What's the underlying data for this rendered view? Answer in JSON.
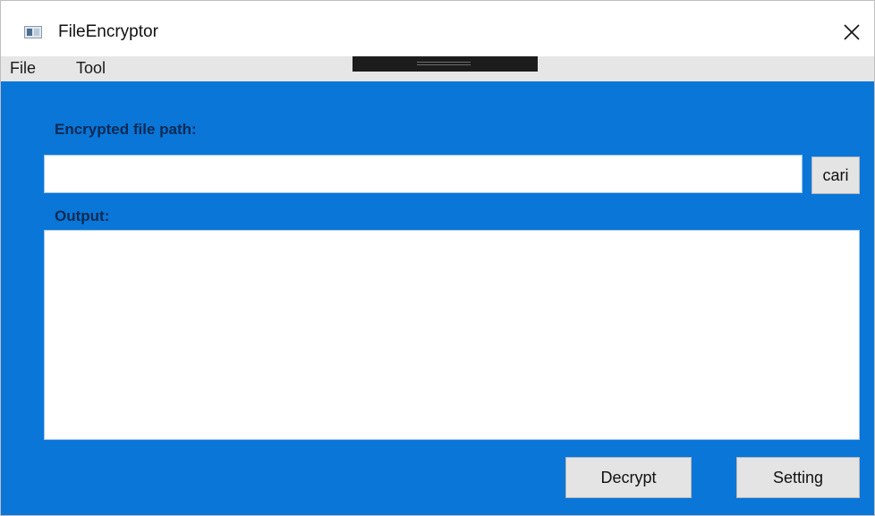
{
  "window": {
    "title": "FileEncryptor",
    "app_icon": "window-app-icon",
    "close_icon": "close-icon"
  },
  "menu": {
    "items": [
      {
        "label": "File"
      },
      {
        "label": "Tool"
      }
    ]
  },
  "form": {
    "path_label": "Encrypted file path:",
    "path_value": "",
    "browse_label": "cari",
    "output_label": "Output:",
    "output_value": ""
  },
  "actions": {
    "decrypt_label": "Decrypt",
    "setting_label": "Setting"
  },
  "colors": {
    "background": "#0a76d8",
    "label_text": "#0d2a53",
    "button_face": "#e4e4e4",
    "menubar": "#e6e6e6"
  }
}
